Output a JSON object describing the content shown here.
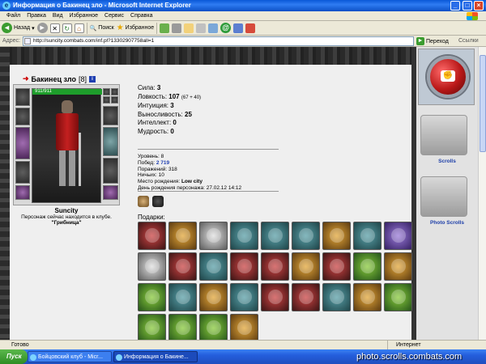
{
  "window": {
    "title": "Информация о Бакинец зло - Microsoft Internet Explorer"
  },
  "menu": [
    "Файл",
    "Правка",
    "Вид",
    "Избранное",
    "Сервис",
    "Справка"
  ],
  "toolbar": {
    "back": "Назад",
    "search": "Поиск",
    "favorites": "Избранное"
  },
  "address": {
    "label": "Адрес:",
    "url": "http://suncity.combats.com/inf.pl?13302907758all=1",
    "go": "Переход",
    "links": "Ссылки"
  },
  "character": {
    "nick": "Бакинец зло",
    "level": "[8]",
    "hp": "911/911",
    "city": "Suncity",
    "location_text": "Персонаж сейчас находится в клубе.",
    "club": "\"Грибница\""
  },
  "stats": [
    {
      "label": "Сила:",
      "value": "3",
      "extra": ""
    },
    {
      "label": "Ловкость:",
      "value": "107",
      "extra": "(67 + 40)"
    },
    {
      "label": "Интуиция:",
      "value": "3",
      "extra": ""
    },
    {
      "label": "Выносливость:",
      "value": "25",
      "extra": ""
    },
    {
      "label": "Интеллект:",
      "value": "0",
      "extra": ""
    },
    {
      "label": "Мудрость:",
      "value": "0",
      "extra": ""
    }
  ],
  "info": {
    "level": "Уровень: 8",
    "wins_label": "Побед:",
    "wins_value": "2 719",
    "losses": "Поражений: 318",
    "draws": "Ничьих: 10",
    "birthplace_label": "Место рождения:",
    "birthplace_value": "Low city",
    "birthday_label": "День рождения персонажа:",
    "birthday_value": "27.02.12 14:12"
  },
  "gifts": {
    "title": "Подарки:",
    "items": [
      "g-red",
      "g-gold",
      "g-silver",
      "g-teal",
      "g-teal",
      "g-teal",
      "g-gold",
      "g-teal",
      "g-purple",
      "g-silver",
      "g-red",
      "g-teal",
      "g-red",
      "g-red",
      "g-gold",
      "g-red",
      "g-green",
      "g-gold",
      "g-green",
      "g-teal",
      "g-gold",
      "g-teal",
      "g-red",
      "g-red",
      "g-teal",
      "g-gold",
      "g-green",
      "g-green",
      "g-green",
      "g-green",
      "g-gold"
    ]
  },
  "sidebar": {
    "scrolls": "Scrolls",
    "photo": "Photo Scrolls"
  },
  "status": {
    "ready": "Готово",
    "zone": "Интернет"
  },
  "taskbar": {
    "start": "Пуск",
    "task1": "Бойцовский клуб - Micr...",
    "task2": "Информация о Бакине...",
    "watermark": "photo.scrolls.combats.com"
  }
}
